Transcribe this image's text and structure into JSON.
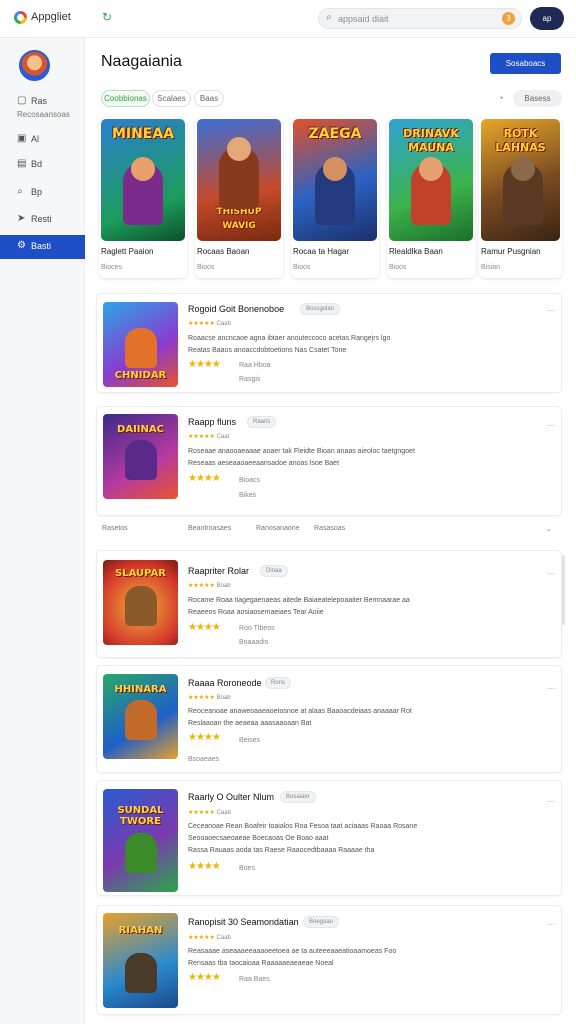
{
  "topbar": {
    "app_title": "Appgliet",
    "search_placeholder": "appsaid diait",
    "badge": "3",
    "avatar": "ap"
  },
  "sidebar": {
    "items": [
      {
        "label": "Ras",
        "sub": "Recosaansoas",
        "icon": "home-icon"
      },
      {
        "label": "Al",
        "icon": "grid-icon"
      },
      {
        "label": "Bd",
        "icon": "bookmark-icon"
      },
      {
        "label": "Bp",
        "icon": "search-icon"
      },
      {
        "label": "Resti",
        "icon": "send-icon"
      },
      {
        "label": "Basti",
        "icon": "settings-icon"
      }
    ]
  },
  "main": {
    "title": "Naagaiania",
    "primary_button": "Sosaboacs",
    "chips": [
      "Coobbionas",
      "Scalaes",
      "Baas"
    ],
    "sort_label": "Basess"
  },
  "featured": [
    {
      "title": "MINEAA",
      "name": "Raglett Paaion",
      "meta": "Bioces"
    },
    {
      "title": "THISHUP WAVIG",
      "name": "Rocaas Baoan",
      "meta": "Bioos"
    },
    {
      "title": "ZAEGA",
      "name": "Rocaa ta Hagar",
      "meta": "Bioos"
    },
    {
      "title": "DRINAVK MAUNA",
      "name": "Rlealdlka Baan",
      "meta": "Bioos"
    },
    {
      "title": "ROTK LAHNAS",
      "name": "Ramur Pusgnian",
      "meta": "Bisian"
    }
  ],
  "list": [
    {
      "thumb_title": "CHNIDAR",
      "title": "Rogoid Goit Bonenoboe",
      "tag": "Boscgolan",
      "rating_text": "Caab",
      "desc": [
        "Roaacse ancncaoe agna ibtaer anouteccoco acetas Rangejrs lgo",
        "Reatas Baaos anoaccdobtoetions Nas Csatet Tone"
      ],
      "meta1": "Raa Hboa",
      "meta2": "Rasgis"
    },
    {
      "thumb_title": "DAIINAC",
      "title": "Raapp fluns",
      "tag": "Raans",
      "rating_text": "Caat",
      "desc": [
        "Roseaae anaooaeaaae aoaer tak Fleidte Bioan anaas aieoloc taetgngoet",
        "Reseaas aeseaaoaeeaansadoe anoas lsoe Baet"
      ],
      "meta1": "Bioacs",
      "meta2": "Bikes"
    },
    {
      "thumb_title": "SLAUPAR",
      "title": "Raapriter Rolar",
      "tag": "Dinaa",
      "rating_text": "Boab",
      "desc": [
        "Rocame Roaa tiagegaenaeas aitede Baiaeatelepoaaiter Bemnaarae aa",
        "Reaeeos Roaa aosiaosemaeiaes Tear Aoiie"
      ],
      "meta1": "Roo Tlbeos",
      "meta2": "Boaaadis"
    },
    {
      "thumb_title": "HHINARA",
      "title": "Raaaa Roroneode",
      "tag": "Rons",
      "rating_text": "Boab",
      "desc": [
        "Reoceanoae anaweoaaeaoetosnoe at alaas Baaoacdeiaas anaaaar Rot",
        "Reslaaoan the aeaeaa aaasaaoaan Bat"
      ],
      "meta1": "Beises",
      "meta2": "Bsoaeaes"
    },
    {
      "thumb_title": "SUNDAL TWORE",
      "title": "Raarly O Oulter Nlum",
      "tag": "Bosaiaer",
      "rating_text": "Caab",
      "desc": [
        "Ceceanoae Rean Boafeir toaialos Roa Fesoa taat aciaaas Raoaa Rosane",
        "Seooaoecsaeoaeae Boecaoas Oe Boao aaat",
        "Rassa Rauaas aoda tas Raese Raaocedtbaaaa Raaaae tha"
      ],
      "meta1": "Boes",
      "meta2": ""
    },
    {
      "thumb_title": "RIAHAN",
      "title": "Ranopisit 30 Seamondatian",
      "tag": "Boegoao",
      "rating_text": "Caab",
      "desc": [
        "Reasaaae aseaaaeeaaaoeetoea ae ta auteeeaaeatioaamoeas Foo",
        "Rensaas tba taocaioaa Raaaaaeaeaeae Noeal"
      ],
      "meta1": "Raa Baes",
      "meta2": ""
    }
  ],
  "footer_row": {
    "a": "Rasetos",
    "b": "Beantroasaes",
    "c": "Ranosanaone",
    "d": "Rasasoas"
  }
}
